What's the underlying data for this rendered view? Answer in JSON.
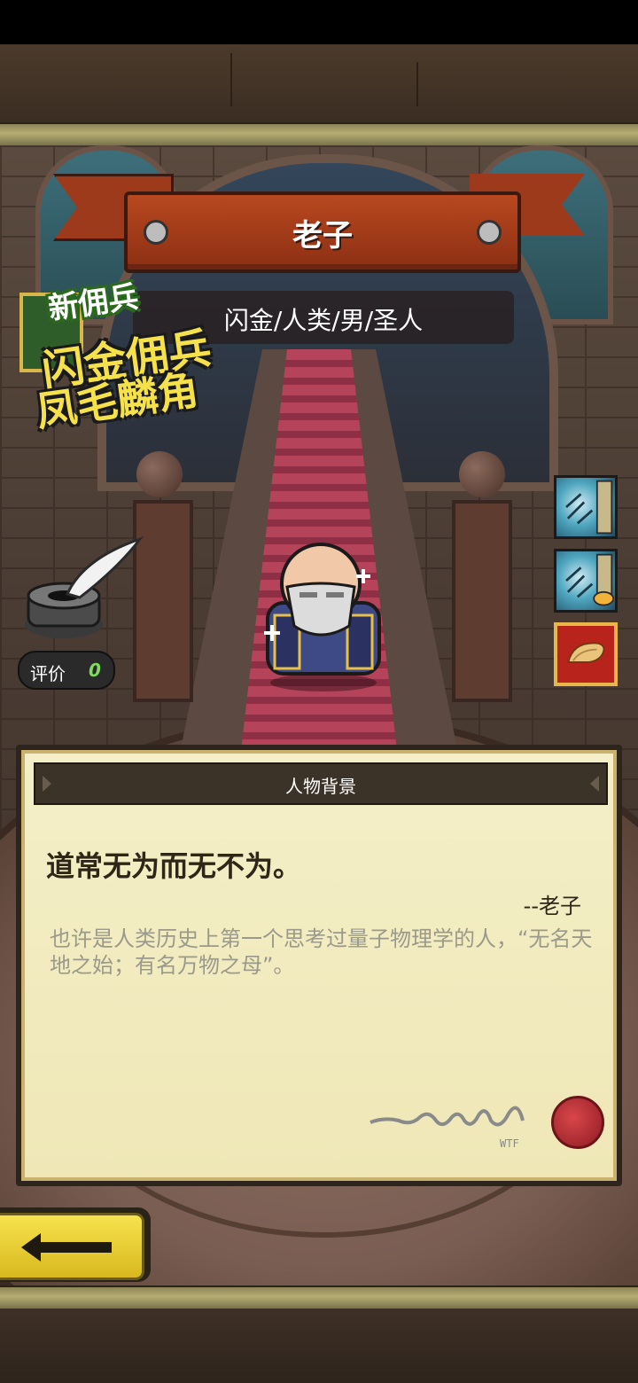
{
  "character": {
    "name": "老子",
    "info": "闪金/人类/男/圣人"
  },
  "promo": {
    "tag": "新佣兵",
    "line1": "闪金佣兵",
    "line2": "凤毛麟角"
  },
  "rating": {
    "label": "评价",
    "value": "0"
  },
  "story_panel": {
    "title": "人物背景",
    "quote": "道常无为而无不为。",
    "quote_author": "--老子",
    "description": "也许是人类历史上第一个思考过量子物理学的人，“无名天地之始；有名万物之母”。"
  },
  "skills": [
    {
      "icon": "frost-shield-icon"
    },
    {
      "icon": "frost-handshake-icon"
    },
    {
      "icon": "scroll-icon"
    }
  ],
  "colors": {
    "banner": "#b8481f",
    "button_yellow": "#f6e34e",
    "parchment": "#f4efc8",
    "rating_value": "#7fdc5a"
  }
}
